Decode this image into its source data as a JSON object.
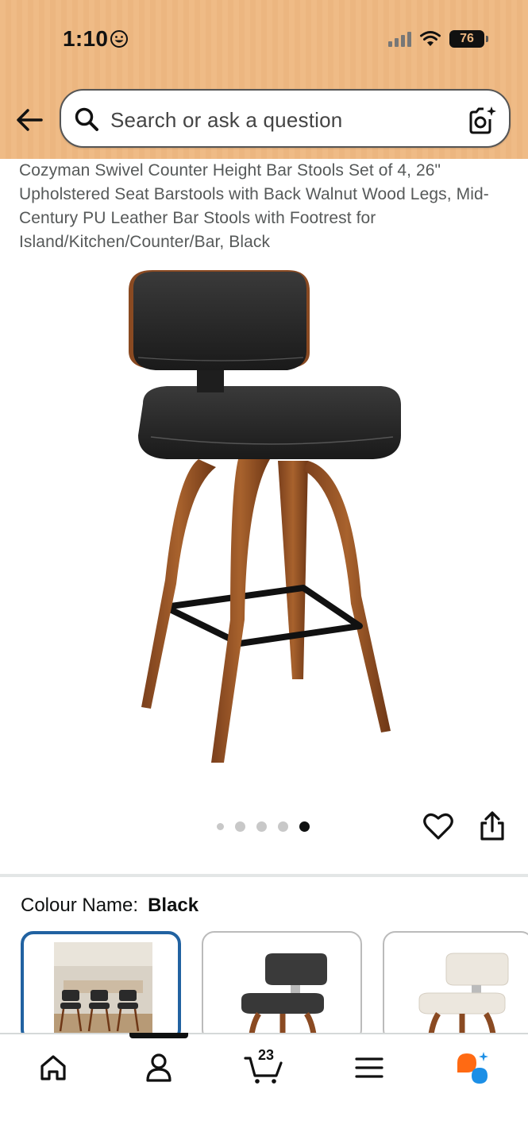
{
  "status_bar": {
    "time": "1:10",
    "battery": "76"
  },
  "search": {
    "placeholder": "Search or ask a question"
  },
  "product": {
    "title": "Cozyman Swivel Counter Height Bar Stools Set of 4, 26\" Upholstered Seat Barstools with Back Walnut Wood Legs, Mid-Century PU Leather Bar Stools with Footrest for Island/Kitchen/Counter/Bar, Black"
  },
  "carousel": {
    "total": 5,
    "active_index": 4
  },
  "colour": {
    "label": "Colour Name:",
    "value": "Black"
  },
  "swatches": [
    {
      "name": "room-scene",
      "selected": true
    },
    {
      "name": "Black",
      "selected": false
    },
    {
      "name": "White",
      "selected": false
    }
  ],
  "bottom_nav": {
    "items": [
      "home-icon",
      "account-icon",
      "cart-icon",
      "menu-icon",
      "ai-assistant-icon"
    ],
    "cart_count": "23",
    "active": "account"
  },
  "colors": {
    "header_bg": "#efbb86",
    "accent_blue": "#2162a1",
    "assistant_orange": "#ff6a13",
    "assistant_blue": "#1c8fe6"
  }
}
